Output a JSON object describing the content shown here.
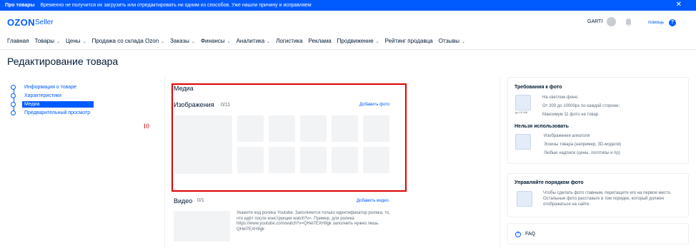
{
  "banner": {
    "label": "Про товары",
    "message": "Временно не получится их загрузить или отредактировать ни одним из способов. Уже нашли причину и исправляем",
    "close": "✕"
  },
  "header": {
    "logo": "OZON",
    "logo_sub": "Seller",
    "user": "GARTI",
    "help": "помощь",
    "help_icon": "?"
  },
  "nav": [
    {
      "label": "Главная",
      "chevron": false
    },
    {
      "label": "Товары",
      "chevron": true
    },
    {
      "label": "Цены",
      "chevron": true
    },
    {
      "label": "Продажа со склада Ozon",
      "chevron": true
    },
    {
      "label": "Заказы",
      "chevron": true
    },
    {
      "label": "Финансы",
      "chevron": true
    },
    {
      "label": "Аналитика",
      "chevron": true
    },
    {
      "label": "Логистика",
      "chevron": false
    },
    {
      "label": "Реклама",
      "chevron": false
    },
    {
      "label": "Продвижение",
      "chevron": true
    },
    {
      "label": "Рейтинг продавца",
      "chevron": false
    },
    {
      "label": "Отзывы",
      "chevron": true
    }
  ],
  "page_title": "Редактирование товара",
  "steps": [
    "Информация о товаре",
    "Характеристики",
    "Медиа",
    "Предварительный просмотр"
  ],
  "number_label": "10",
  "media": {
    "title": "Медиа",
    "images_title": "Изображения",
    "images_count": "0/11",
    "add_photo": "Добавить фото",
    "video_title": "Видео",
    "video_count": "0/1",
    "add_video": "Добавить видео",
    "video_hint": "Укажите код ролика Youtube. Заполняется только идентификатор ролика, то, что идёт после конструкции watch?v=. Пример, для ролика https://www.youtube.com/watch?v=QHel7EXH9gk заполнить нужно лишь QHel7EXH9gk"
  },
  "requirements": {
    "title": "Требования к фото",
    "lines": [
      "На светлом фоне;",
      "От 200 до 10000px по каждой стороне;",
      "Максимум 11 фото на товар."
    ],
    "thumb_caption": "до 10 МБ",
    "forbidden_title": "Нельзя использовать",
    "forbidden": [
      "Изображения алкоголя",
      "Эскизы товара (например, 3D-модели)",
      "Любые надписи (цены, логотипы и пр)"
    ]
  },
  "order": {
    "title": "Управляйте порядком фото",
    "text": "Чтобы сделать фото главным, перетащите его на первое место. Остальные фото расставьте в том порядке, который должен отображаться на сайте."
  },
  "faq": "FAQ",
  "colors": {
    "brand": "#005bff",
    "highlight": "#e00000"
  }
}
